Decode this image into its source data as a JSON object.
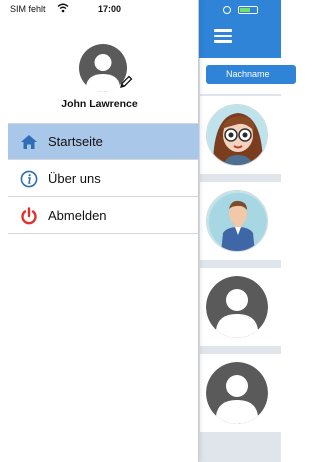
{
  "status_bar": {
    "carrier": "SIM fehlt",
    "time": "17:00"
  },
  "drawer": {
    "profile": {
      "name": "John Lawrence"
    },
    "menu": [
      {
        "label": "Startseite",
        "icon": "home-icon",
        "active": true
      },
      {
        "label": "Über uns",
        "icon": "info-icon",
        "active": false
      },
      {
        "label": "Abmelden",
        "icon": "power-icon",
        "active": false
      }
    ]
  },
  "background_app": {
    "sort_button": "Nachname",
    "contacts": [
      {
        "avatar": "female-cartoon-avatar"
      },
      {
        "avatar": "male-cartoon-avatar"
      },
      {
        "avatar": "placeholder-avatar"
      },
      {
        "avatar": "placeholder-avatar"
      }
    ]
  },
  "colors": {
    "header_blue": "#2f84d8",
    "active_item": "#a9c7e8",
    "logout_red": "#e0322d",
    "placeholder_gray": "#5a5a5a"
  }
}
